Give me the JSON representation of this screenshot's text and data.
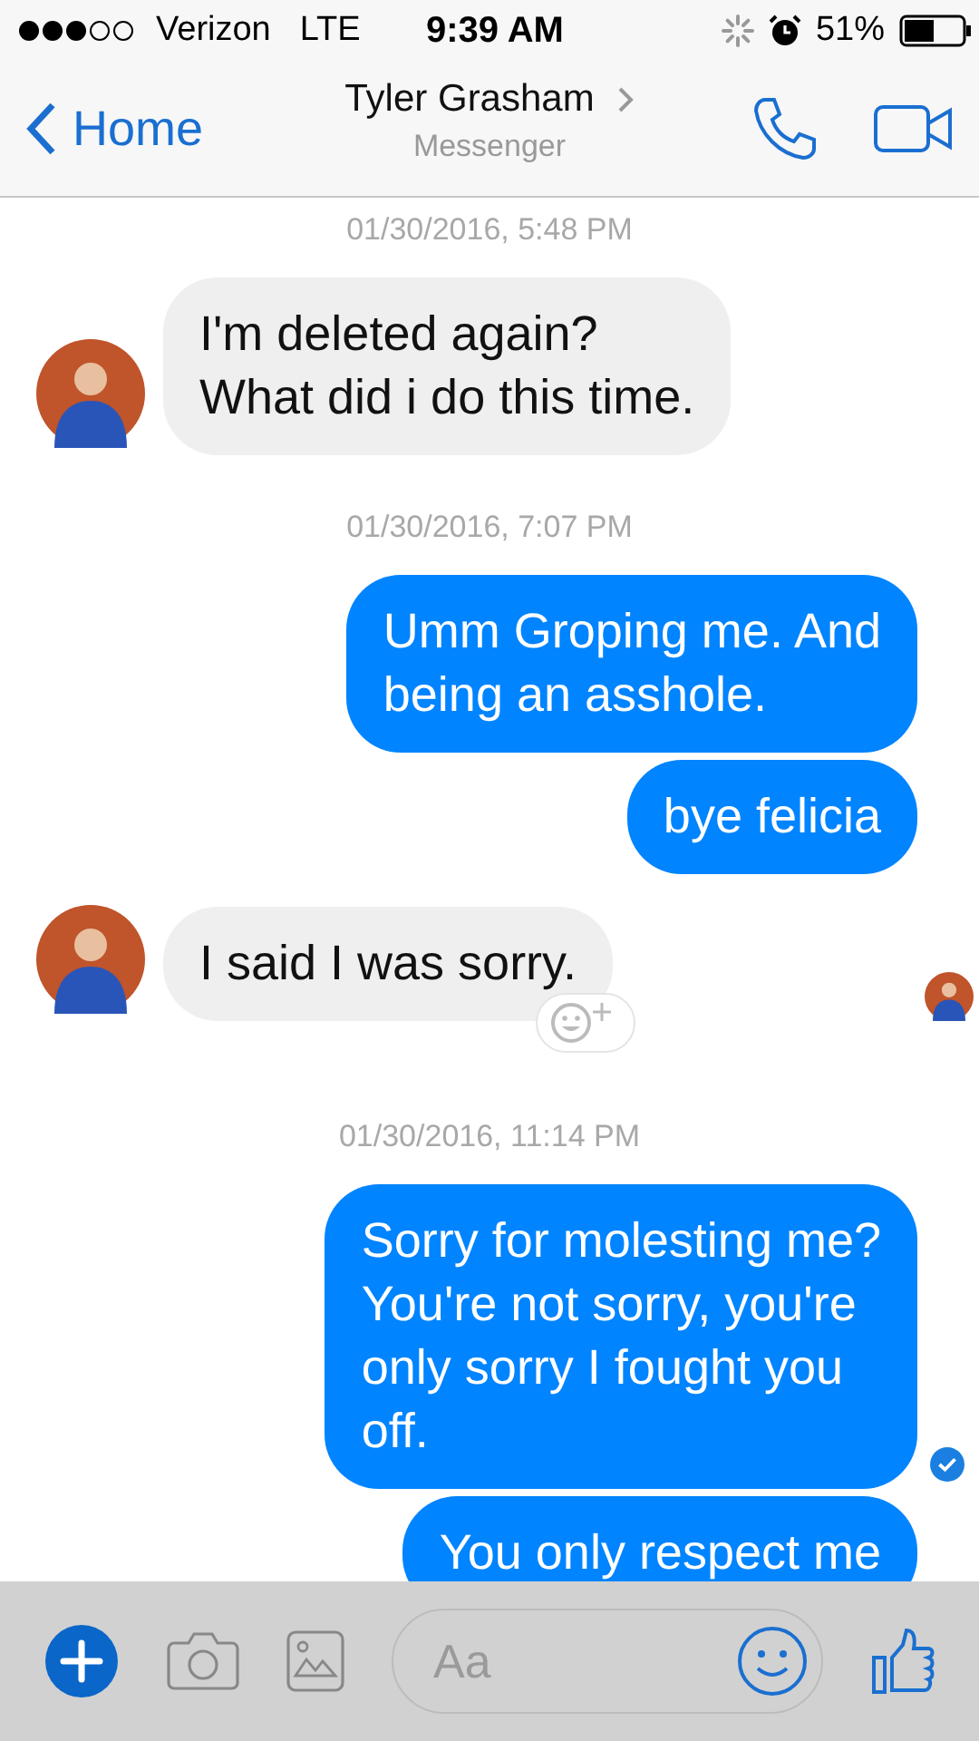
{
  "status_bar": {
    "carrier": "Verizon",
    "network": "LTE",
    "time": "9:39 AM",
    "battery": "51%"
  },
  "nav": {
    "back": "Home",
    "title": "Tyler Grasham",
    "subtitle": "Messenger"
  },
  "messages": [
    {
      "kind": "timestamp",
      "text": "01/30/2016, 5:48 PM"
    },
    {
      "kind": "incoming",
      "text": "I'm deleted again?\nWhat did i do this time.",
      "seen": false,
      "reaction_button": false
    },
    {
      "kind": "timestamp",
      "text": "01/30/2016, 7:07 PM"
    },
    {
      "kind": "outgoing",
      "text": "Umm Groping me. And\nbeing an asshole.",
      "delivered": false
    },
    {
      "kind": "outgoing",
      "text": "bye felicia",
      "delivered": false
    },
    {
      "kind": "incoming",
      "text": "I said I was sorry.",
      "seen": true,
      "reaction_button": true
    },
    {
      "kind": "timestamp",
      "text": "01/30/2016, 11:14 PM"
    },
    {
      "kind": "outgoing",
      "text": "Sorry for molesting me?\nYou're not sorry, you're\nonly sorry I fought you\noff.",
      "delivered": true
    },
    {
      "kind": "outgoing",
      "text": "You only respect me",
      "delivered": false
    }
  ],
  "composer": {
    "placeholder": "Aa"
  }
}
